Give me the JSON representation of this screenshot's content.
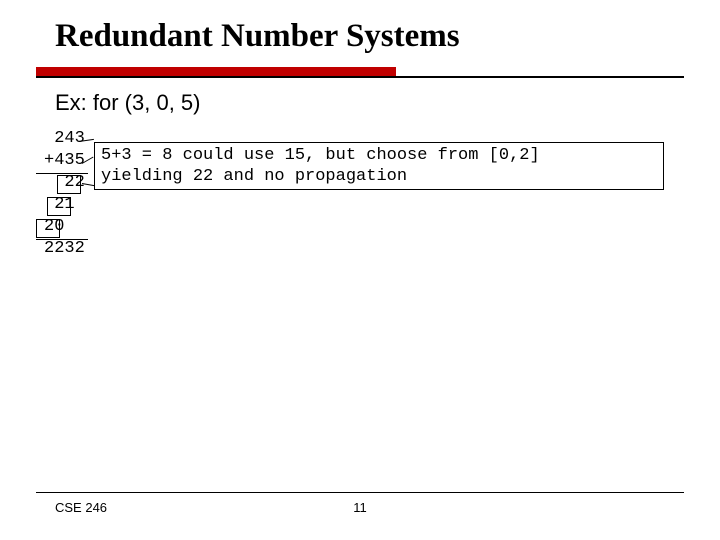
{
  "title": "Redundant Number Systems",
  "subtitle": "Ex: for (3, 0, 5)",
  "addition": {
    "line1": " 243",
    "line2": "+435",
    "p22": "  22",
    "p21": " 21",
    "p20": "20",
    "result": "2232"
  },
  "note": {
    "line1": "5+3 = 8 could use 15, but choose from [0,2]",
    "line2": "yielding 22 and no propagation"
  },
  "footer": {
    "course": "CSE 246",
    "page": "11"
  }
}
